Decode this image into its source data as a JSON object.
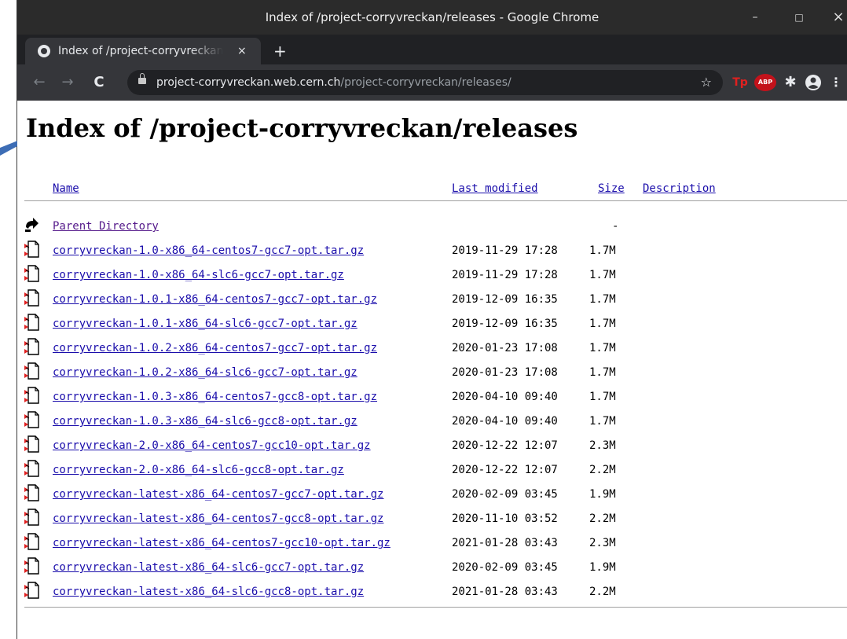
{
  "window": {
    "title": "Index of /project-corryvreckan/releases - Google Chrome",
    "controls": {
      "minimize": "–",
      "maximize": "□",
      "close": "×"
    }
  },
  "tab": {
    "label": "Index of /project-corryvreckan/releases",
    "close": "×",
    "new_tab": "+"
  },
  "toolbar": {
    "back": "←",
    "forward": "→",
    "reload": "C",
    "url_host": "project-corryvreckan.web.cern.ch",
    "url_path": "/project-corryvreckan/releases/",
    "bookmark": "☆",
    "extensions": {
      "tp": "Tp",
      "abp": "ABP",
      "puzzle": "✱",
      "menu": "⋮"
    }
  },
  "page": {
    "heading": "Index of /project-corryvreckan/releases",
    "columns": {
      "name": "Name",
      "last_modified": "Last modified",
      "size": "Size",
      "description": "Description"
    },
    "parent": {
      "name": "Parent Directory",
      "size": "-"
    },
    "files": [
      {
        "name": "corryvreckan-1.0-x86_64-centos7-gcc7-opt.tar.gz",
        "modified": "2019-11-29 17:28",
        "size": "1.7M"
      },
      {
        "name": "corryvreckan-1.0-x86_64-slc6-gcc7-opt.tar.gz",
        "modified": "2019-11-29 17:28",
        "size": "1.7M"
      },
      {
        "name": "corryvreckan-1.0.1-x86_64-centos7-gcc7-opt.tar.gz",
        "modified": "2019-12-09 16:35",
        "size": "1.7M"
      },
      {
        "name": "corryvreckan-1.0.1-x86_64-slc6-gcc7-opt.tar.gz",
        "modified": "2019-12-09 16:35",
        "size": "1.7M"
      },
      {
        "name": "corryvreckan-1.0.2-x86_64-centos7-gcc7-opt.tar.gz",
        "modified": "2020-01-23 17:08",
        "size": "1.7M"
      },
      {
        "name": "corryvreckan-1.0.2-x86_64-slc6-gcc7-opt.tar.gz",
        "modified": "2020-01-23 17:08",
        "size": "1.7M"
      },
      {
        "name": "corryvreckan-1.0.3-x86_64-centos7-gcc8-opt.tar.gz",
        "modified": "2020-04-10 09:40",
        "size": "1.7M"
      },
      {
        "name": "corryvreckan-1.0.3-x86_64-slc6-gcc8-opt.tar.gz",
        "modified": "2020-04-10 09:40",
        "size": "1.7M"
      },
      {
        "name": "corryvreckan-2.0-x86_64-centos7-gcc10-opt.tar.gz",
        "modified": "2020-12-22 12:07",
        "size": "2.3M"
      },
      {
        "name": "corryvreckan-2.0-x86_64-slc6-gcc8-opt.tar.gz",
        "modified": "2020-12-22 12:07",
        "size": "2.2M"
      },
      {
        "name": "corryvreckan-latest-x86_64-centos7-gcc7-opt.tar.gz",
        "modified": "2020-02-09 03:45",
        "size": "1.9M"
      },
      {
        "name": "corryvreckan-latest-x86_64-centos7-gcc8-opt.tar.gz",
        "modified": "2020-11-10 03:52",
        "size": "2.2M"
      },
      {
        "name": "corryvreckan-latest-x86_64-centos7-gcc10-opt.tar.gz",
        "modified": "2021-01-28 03:43",
        "size": "2.3M"
      },
      {
        "name": "corryvreckan-latest-x86_64-slc6-gcc7-opt.tar.gz",
        "modified": "2020-02-09 03:45",
        "size": "1.9M"
      },
      {
        "name": "corryvreckan-latest-x86_64-slc6-gcc8-opt.tar.gz",
        "modified": "2021-01-28 03:43",
        "size": "2.2M"
      }
    ]
  },
  "colors": {
    "link": "#1a0dab",
    "visited": "#551a8b",
    "titlebar": "#2b2b2b",
    "toolbar": "#35363a",
    "annotation_arrow": "#3d6db5"
  }
}
